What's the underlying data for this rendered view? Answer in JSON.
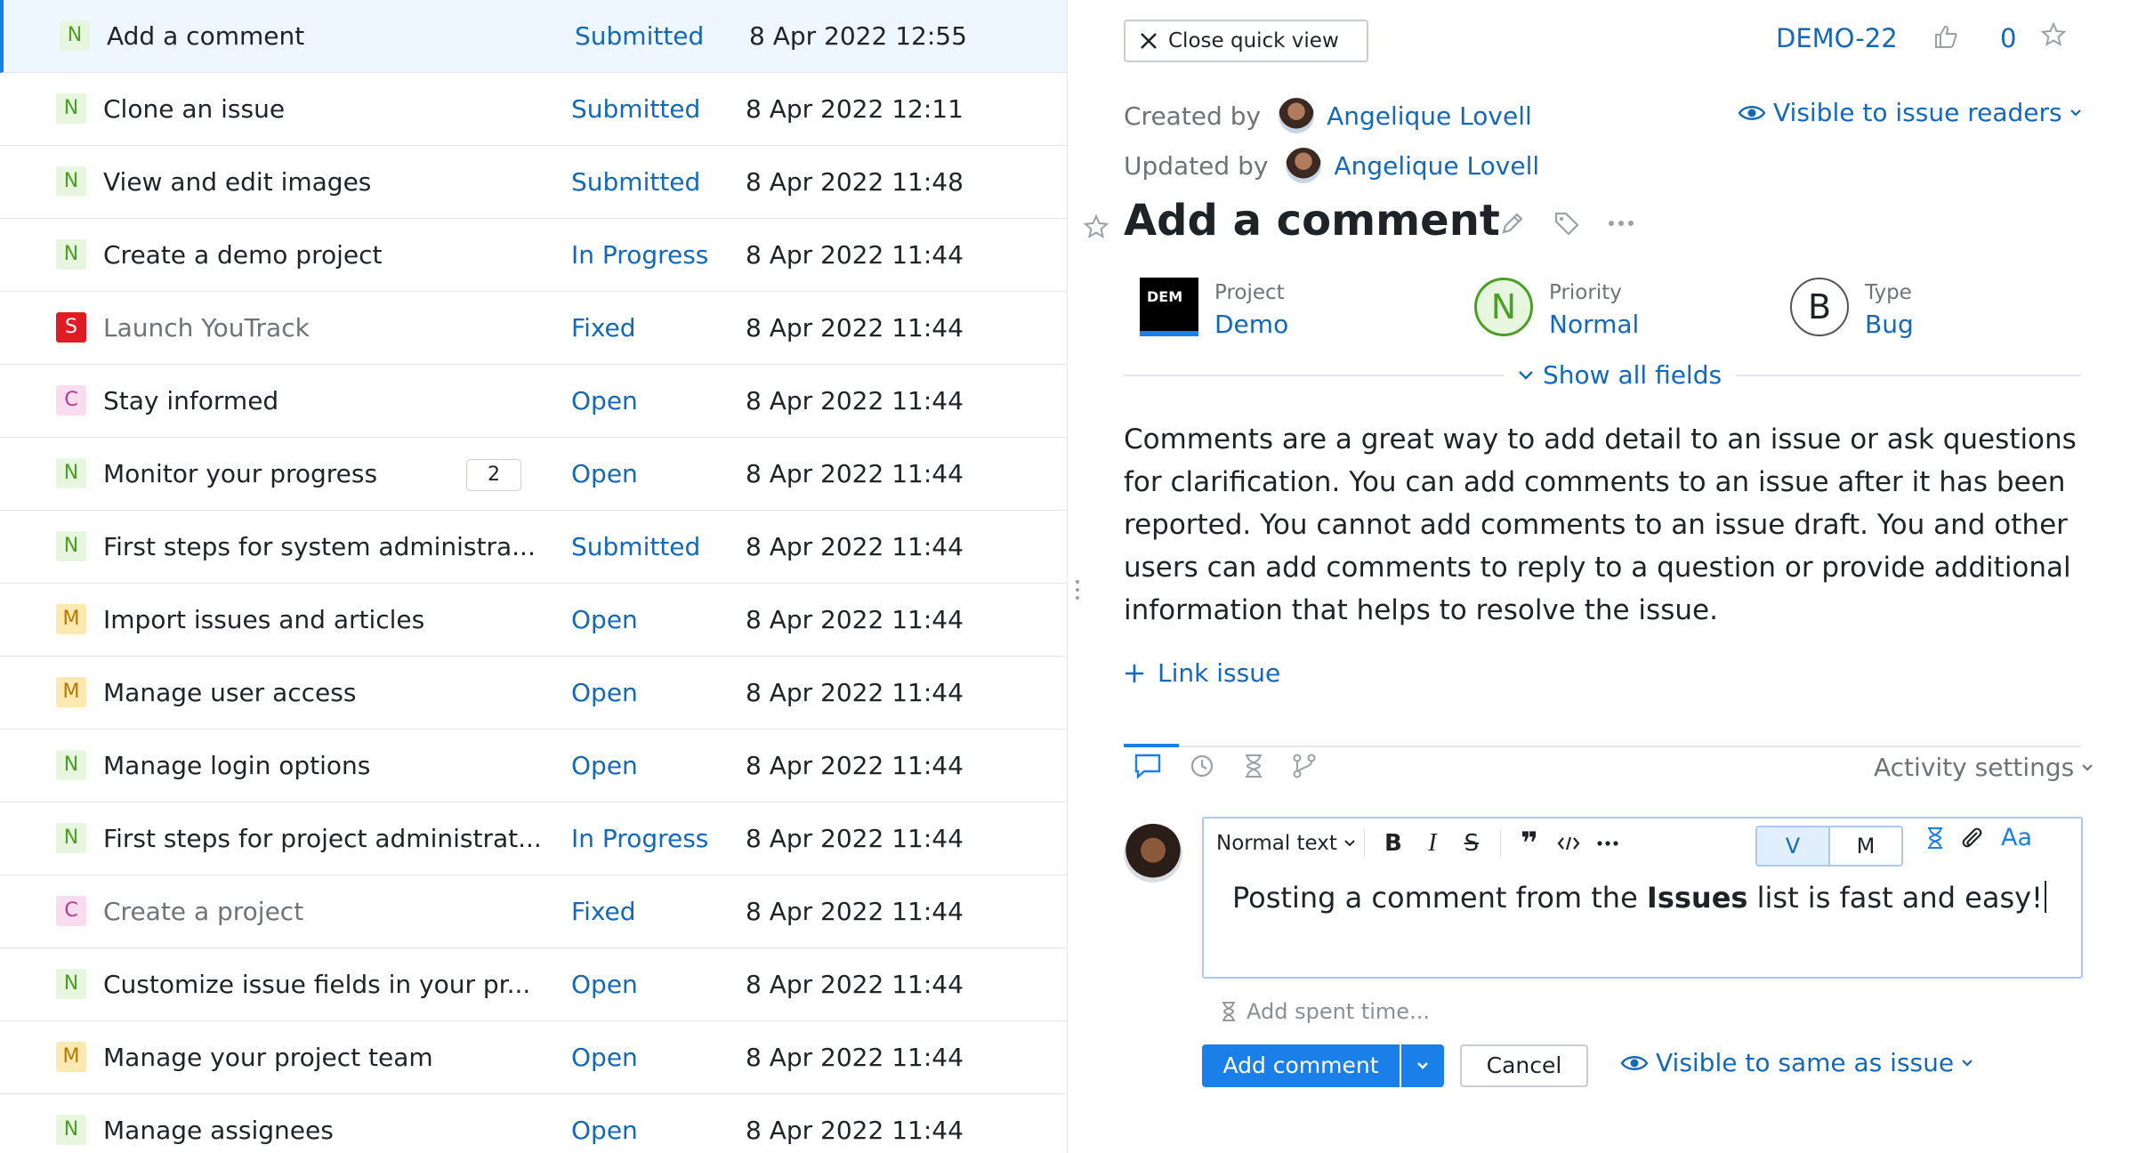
{
  "issues": [
    {
      "priority": "N",
      "summary": "Add a comment",
      "state": "Submitted",
      "date": "8 Apr 2022 12:55",
      "resolved": false,
      "selected": true
    },
    {
      "priority": "N",
      "summary": "Clone an issue",
      "state": "Submitted",
      "date": "8 Apr 2022 12:11",
      "resolved": false
    },
    {
      "priority": "N",
      "summary": "View and edit images",
      "state": "Submitted",
      "date": "8 Apr 2022 11:48",
      "resolved": false
    },
    {
      "priority": "N",
      "summary": "Create a demo project",
      "state": "In Progress",
      "date": "8 Apr 2022 11:44",
      "resolved": false
    },
    {
      "priority": "S",
      "summary": "Launch YouTrack",
      "state": "Fixed",
      "date": "8 Apr 2022 11:44",
      "resolved": true
    },
    {
      "priority": "C",
      "summary": "Stay informed",
      "state": "Open",
      "date": "8 Apr 2022 11:44",
      "resolved": false
    },
    {
      "priority": "N",
      "summary": "Monitor your progress",
      "state": "Open",
      "date": "8 Apr 2022 11:44",
      "resolved": false,
      "comments": "2"
    },
    {
      "priority": "N",
      "summary": "First steps for system administra...",
      "state": "Submitted",
      "date": "8 Apr 2022 11:44",
      "resolved": false
    },
    {
      "priority": "M",
      "summary": "Import issues and articles",
      "state": "Open",
      "date": "8 Apr 2022 11:44",
      "resolved": false
    },
    {
      "priority": "M",
      "summary": "Manage user access",
      "state": "Open",
      "date": "8 Apr 2022 11:44",
      "resolved": false
    },
    {
      "priority": "N",
      "summary": "Manage login options",
      "state": "Open",
      "date": "8 Apr 2022 11:44",
      "resolved": false
    },
    {
      "priority": "N",
      "summary": "First steps for project administrat...",
      "state": "In Progress",
      "date": "8 Apr 2022 11:44",
      "resolved": false
    },
    {
      "priority": "C",
      "summary": "Create a project",
      "state": "Fixed",
      "date": "8 Apr 2022 11:44",
      "resolved": true
    },
    {
      "priority": "N",
      "summary": "Customize issue fields in your pr...",
      "state": "Open",
      "date": "8 Apr 2022 11:44",
      "resolved": false
    },
    {
      "priority": "M",
      "summary": "Manage your project team",
      "state": "Open",
      "date": "8 Apr 2022 11:44",
      "resolved": false
    },
    {
      "priority": "N",
      "summary": "Manage assignees",
      "state": "Open",
      "date": "8 Apr 2022 11:44",
      "resolved": false
    }
  ],
  "quickview": {
    "close_label": "Close quick view",
    "issue_id": "DEMO-22",
    "votes": "0",
    "created_label": "Created by",
    "created_by": "Angelique Lovell",
    "updated_label": "Updated by",
    "updated_by": "Angelique Lovell",
    "visibility": "Visible to issue readers",
    "title": "Add a comment",
    "fields": {
      "project_label": "Project",
      "project_value": "Demo",
      "project_icon_text": "DEM",
      "priority_label": "Priority",
      "priority_value": "Normal",
      "priority_letter": "N",
      "type_label": "Type",
      "type_value": "Bug",
      "type_letter": "B"
    },
    "show_all_fields": "Show all fields",
    "description": "Comments are a great way to add detail to an issue or ask questions for clarification. You can add comments to an issue after it has been reported. You cannot add comments to an issue draft. You and other users can add comments to reply to a question or provide additional information that helps to resolve the issue.",
    "link_issue": "Link issue",
    "activity_settings": "Activity settings"
  },
  "editor": {
    "format": "Normal text",
    "mode_visual": "V",
    "mode_markdown": "M",
    "text_before": "Posting a comment from the ",
    "text_bold": "Issues",
    "text_after": " list is fast and easy!",
    "spent_time": "Add spent time...",
    "add_comment": "Add comment",
    "cancel": "Cancel",
    "visibility": "Visible to same as issue",
    "font_toggle": "Aa"
  },
  "colors": {
    "accent": "#1a7fe8",
    "link": "#1468b8",
    "priority_normal": "#4d9e26",
    "priority_show_stopper": "#e01b24"
  }
}
